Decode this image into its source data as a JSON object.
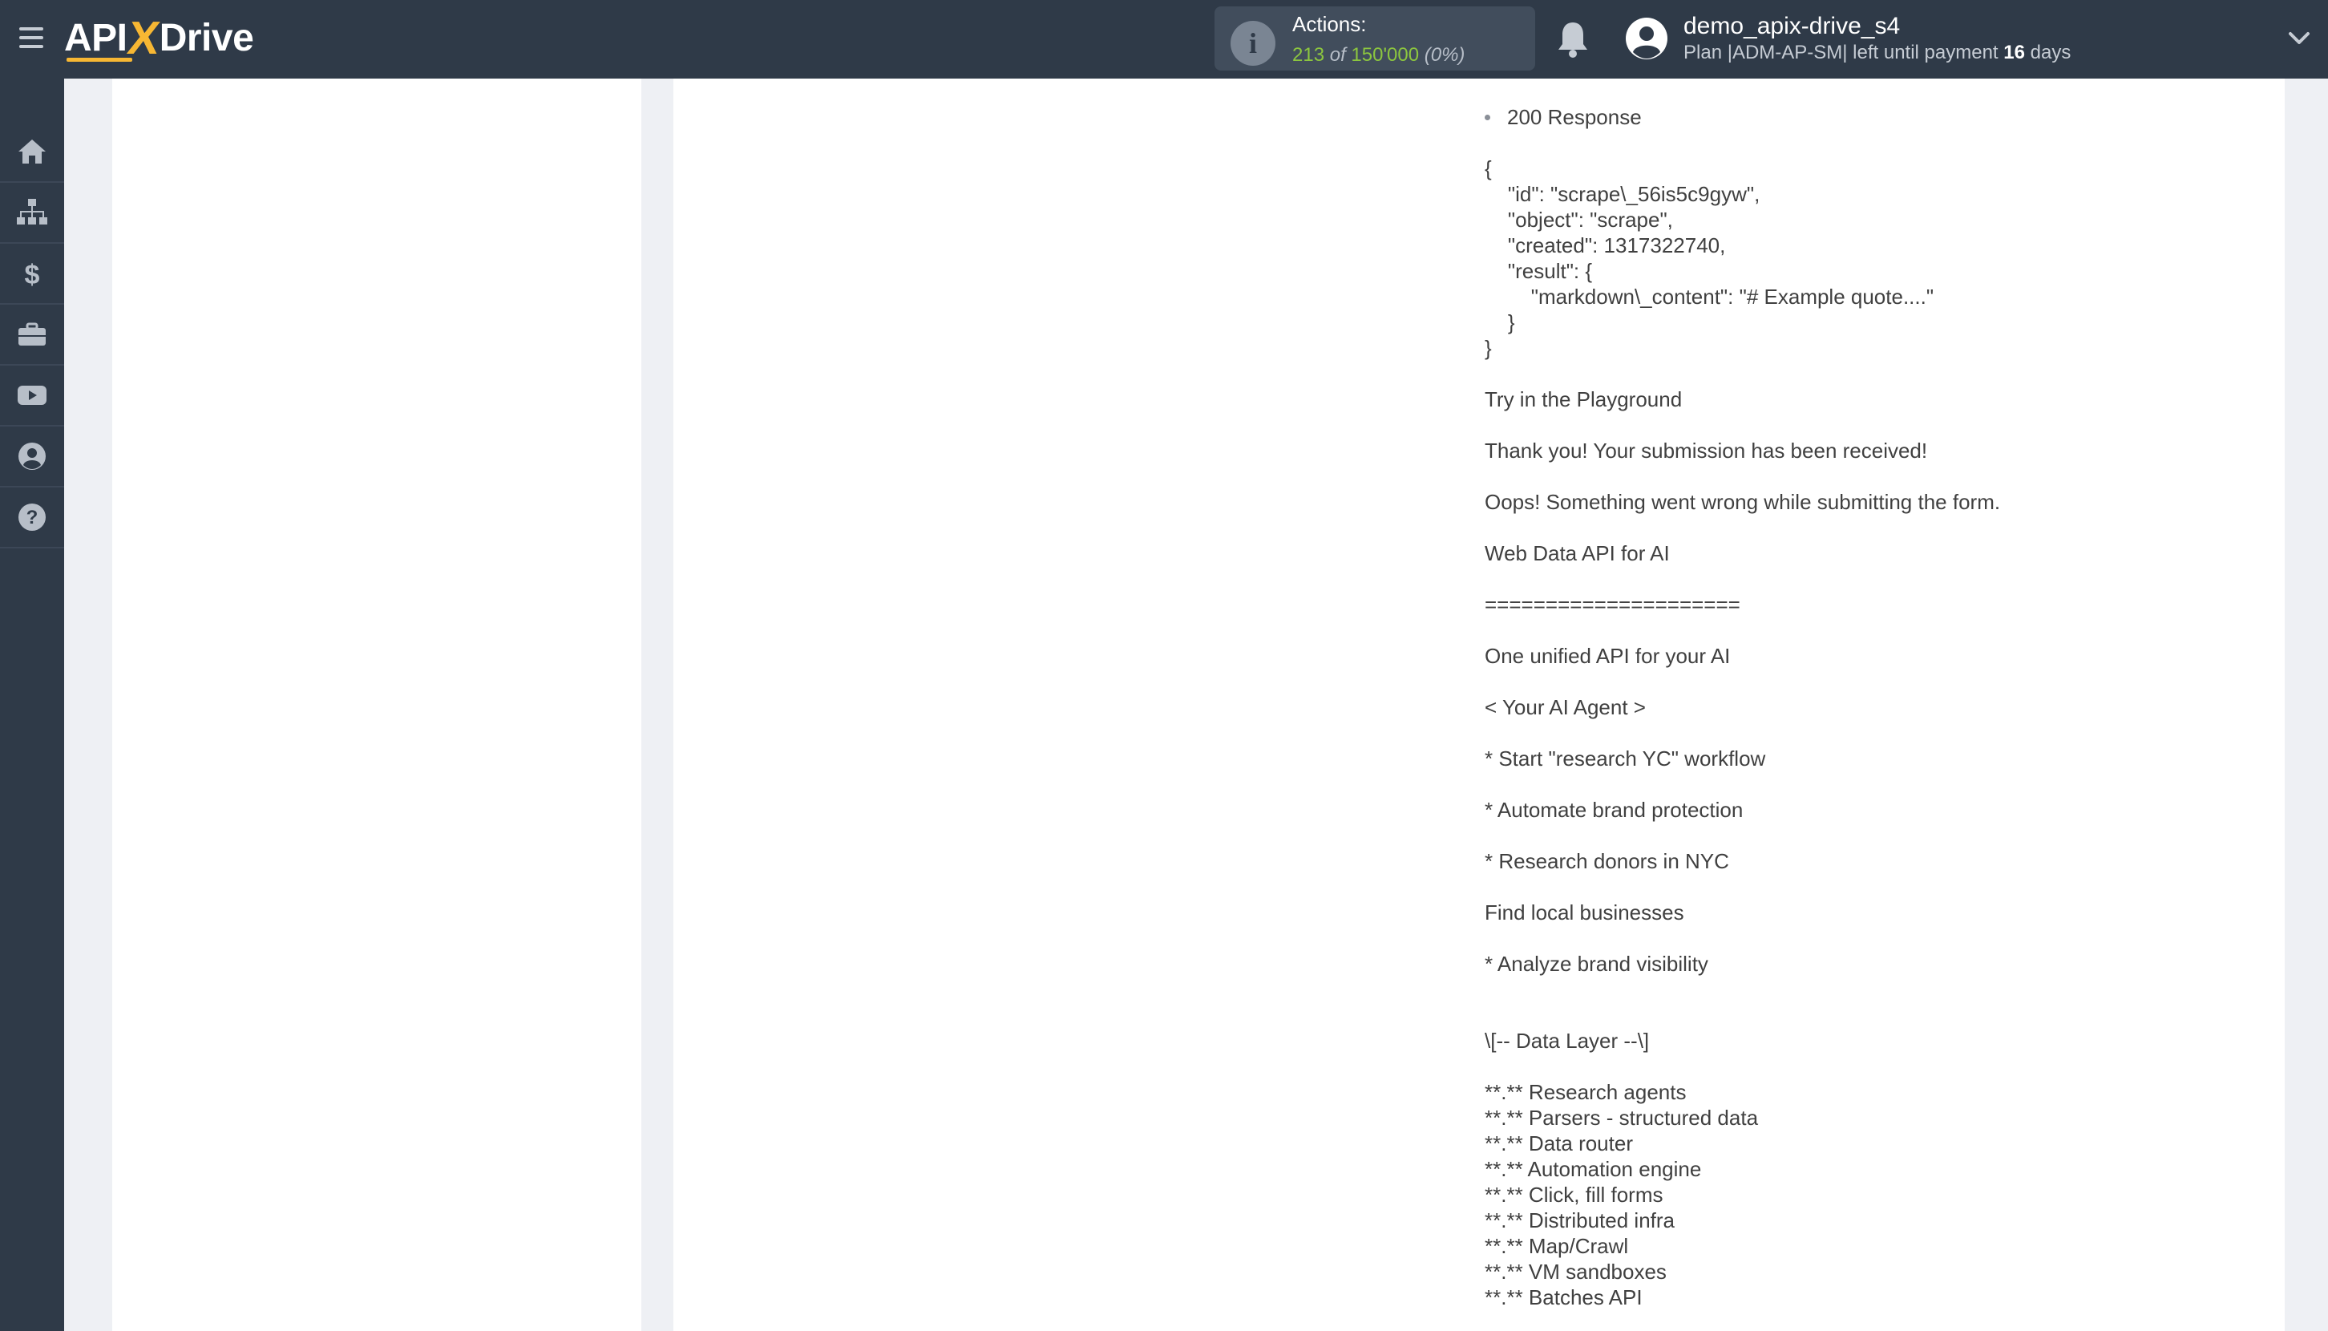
{
  "header": {
    "logo_text_left": "API",
    "logo_text_x": "X",
    "logo_text_right": "Drive",
    "actions": {
      "label": "Actions:",
      "used": "213",
      "of_word": "of",
      "total": "150'000",
      "percent": "(0%)"
    },
    "user": {
      "name": "demo_apix-drive_s4",
      "plan_prefix": "Plan |ADM-AP-SM| left until payment ",
      "days_count": "16",
      "days_suffix": " days"
    },
    "icons": {
      "menu": "hamburger-icon",
      "info": "info-icon",
      "notifications": "bell-icon",
      "avatar": "user-avatar-icon",
      "dropdown": "chevron-down-icon"
    }
  },
  "sidebar": {
    "items": [
      {
        "icon": "home-icon"
      },
      {
        "icon": "sitemap-icon"
      },
      {
        "icon": "dollar-icon"
      },
      {
        "icon": "briefcase-icon"
      },
      {
        "icon": "youtube-icon"
      },
      {
        "icon": "user-circle-icon"
      },
      {
        "icon": "question-icon"
      }
    ]
  },
  "content": {
    "lines": [
      "200 Response",
      "{",
      "    \"id\": \"scrape\\_56is5c9gyw\",",
      "    \"object\": \"scrape\",",
      "    \"created\": 1317322740,",
      "    \"result\": {",
      "        \"markdown\\_content\": \"# Example quote....\"",
      "    }",
      "}",
      "Try in the Playground",
      "Thank you! Your submission has been received!",
      "Oops! Something went wrong while submitting the form.",
      "Web Data API for AI",
      "=====================",
      "One unified API for your AI",
      "< Your AI Agent >",
      "* Start \"research YC\" workflow",
      "* Automate brand protection",
      "* Research donors in NYC",
      "Find local businesses",
      "* Analyze brand visibility",
      "\\[-- Data Layer --\\]",
      "**.** Research agents",
      "**.** Parsers - structured data",
      "**.** Data router",
      "**.** Automation engine",
      "**.** Click, fill forms",
      "**.** Distributed infra",
      "**.** Map/Crawl",
      "**.** VM sandboxes",
      "**.** Batches API"
    ]
  },
  "colors": {
    "header_bg": "#2f3a48",
    "accent_yellow": "#f7b733",
    "actions_green": "#8cc63f",
    "page_bg": "#eef0f4"
  }
}
